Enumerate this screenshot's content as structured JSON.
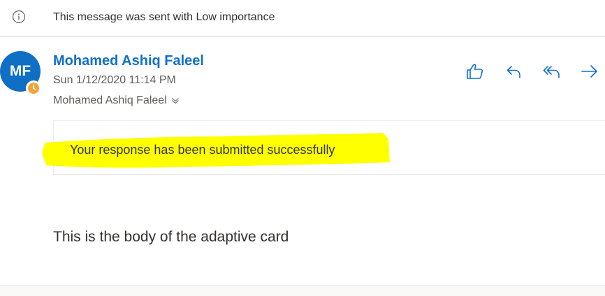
{
  "banner": {
    "icon": "info-icon",
    "text": "This message was sent with Low importance"
  },
  "message": {
    "avatar": {
      "initials": "MF",
      "color": "#0e6fc4",
      "presence_icon": "clock-icon",
      "presence_color": "#f2a33a"
    },
    "sender_name": "Mohamed Ashiq Faleel",
    "sender_color": "#1170c8",
    "sent_date": "Sun 1/12/2020 11:14 PM",
    "recipient": "Mohamed Ashiq Faleel",
    "recipient_expand_icon": "chevron-down-icon",
    "actions": [
      {
        "name": "like",
        "icon": "thumbs-up-icon"
      },
      {
        "name": "reply",
        "icon": "reply-icon"
      },
      {
        "name": "reply-all",
        "icon": "reply-all-icon"
      },
      {
        "name": "forward",
        "icon": "forward-icon"
      }
    ]
  },
  "card": {
    "response_text": "Your response has been submitted successfully",
    "highlight_color": "#ffff00",
    "body_text": "This is the body of the adaptive card"
  }
}
